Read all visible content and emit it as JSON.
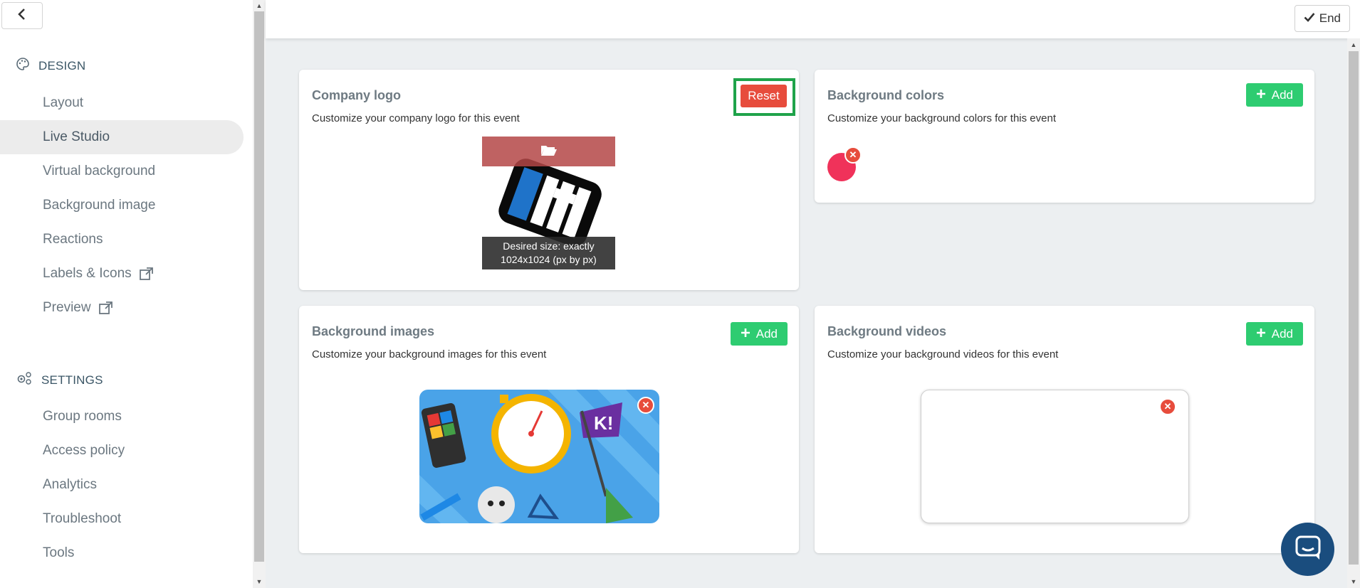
{
  "sidebar": {
    "design_heading": "DESIGN",
    "design_items": [
      {
        "label": "Layout"
      },
      {
        "label": "Live Studio"
      },
      {
        "label": "Virtual background"
      },
      {
        "label": "Background image"
      },
      {
        "label": "Reactions"
      },
      {
        "label": "Labels & Icons"
      },
      {
        "label": "Preview"
      }
    ],
    "settings_heading": "SETTINGS",
    "settings_items": [
      {
        "label": "Group rooms"
      },
      {
        "label": "Access policy"
      },
      {
        "label": "Analytics"
      },
      {
        "label": "Troubleshoot"
      },
      {
        "label": "Tools"
      }
    ],
    "active_item": "Live Studio"
  },
  "topbar": {
    "end_label": "End"
  },
  "cards": {
    "company_logo": {
      "title": "Company logo",
      "desc": "Customize your company logo for this event",
      "reset_label": "Reset",
      "size_hint_line1": "Desired size: exactly",
      "size_hint_line2": "1024x1024 (px by px)"
    },
    "background_colors": {
      "title": "Background colors",
      "desc": "Customize your background colors for this event",
      "add_label": "Add",
      "swatch_color": "#f0325a"
    },
    "background_images": {
      "title": "Background images",
      "desc": "Customize your background images for this event",
      "add_label": "Add"
    },
    "background_videos": {
      "title": "Background videos",
      "desc": "Customize your background videos for this event",
      "add_label": "Add"
    }
  },
  "colors": {
    "accent_green": "#2ecc71",
    "danger_red": "#e74c3c",
    "highlight_green": "#1fa34a",
    "chat_blue": "#1a4d7e"
  },
  "icons": [
    "chevron-left-icon",
    "palette-icon",
    "gears-icon",
    "external-link-icon",
    "check-icon",
    "plus-icon",
    "folder-open-icon",
    "close-icon",
    "chat-icon"
  ]
}
